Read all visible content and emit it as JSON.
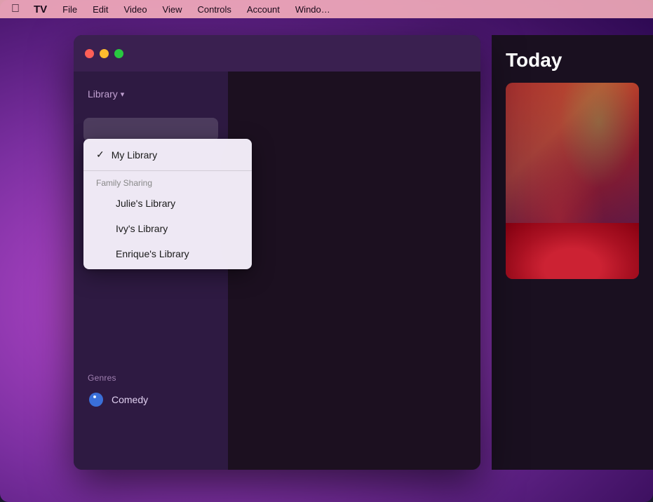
{
  "desktop": {
    "bg_description": "macOS purple gradient desktop"
  },
  "menubar": {
    "items": [
      {
        "id": "apple",
        "label": ""
      },
      {
        "id": "tv",
        "label": "TV"
      },
      {
        "id": "file",
        "label": "File"
      },
      {
        "id": "edit",
        "label": "Edit"
      },
      {
        "id": "video",
        "label": "Video"
      },
      {
        "id": "view",
        "label": "View"
      },
      {
        "id": "controls",
        "label": "Controls"
      },
      {
        "id": "account",
        "label": "Account"
      },
      {
        "id": "window",
        "label": "Windo…"
      }
    ]
  },
  "window": {
    "traffic_lights": {
      "close_label": "",
      "minimize_label": "",
      "maximize_label": ""
    }
  },
  "sidebar": {
    "library_header": "Library",
    "chevron": "▾",
    "genres_label": "Genres",
    "comedy_label": "Comedy"
  },
  "dropdown": {
    "my_library": "My Library",
    "checkmark": "✓",
    "family_sharing_header": "Family Sharing",
    "items": [
      {
        "id": "julies-library",
        "label": "Julie's Library"
      },
      {
        "id": "ivys-library",
        "label": "Ivy's Library"
      },
      {
        "id": "enriques-library",
        "label": "Enrique's Library"
      }
    ]
  },
  "today_panel": {
    "title": "Today"
  }
}
